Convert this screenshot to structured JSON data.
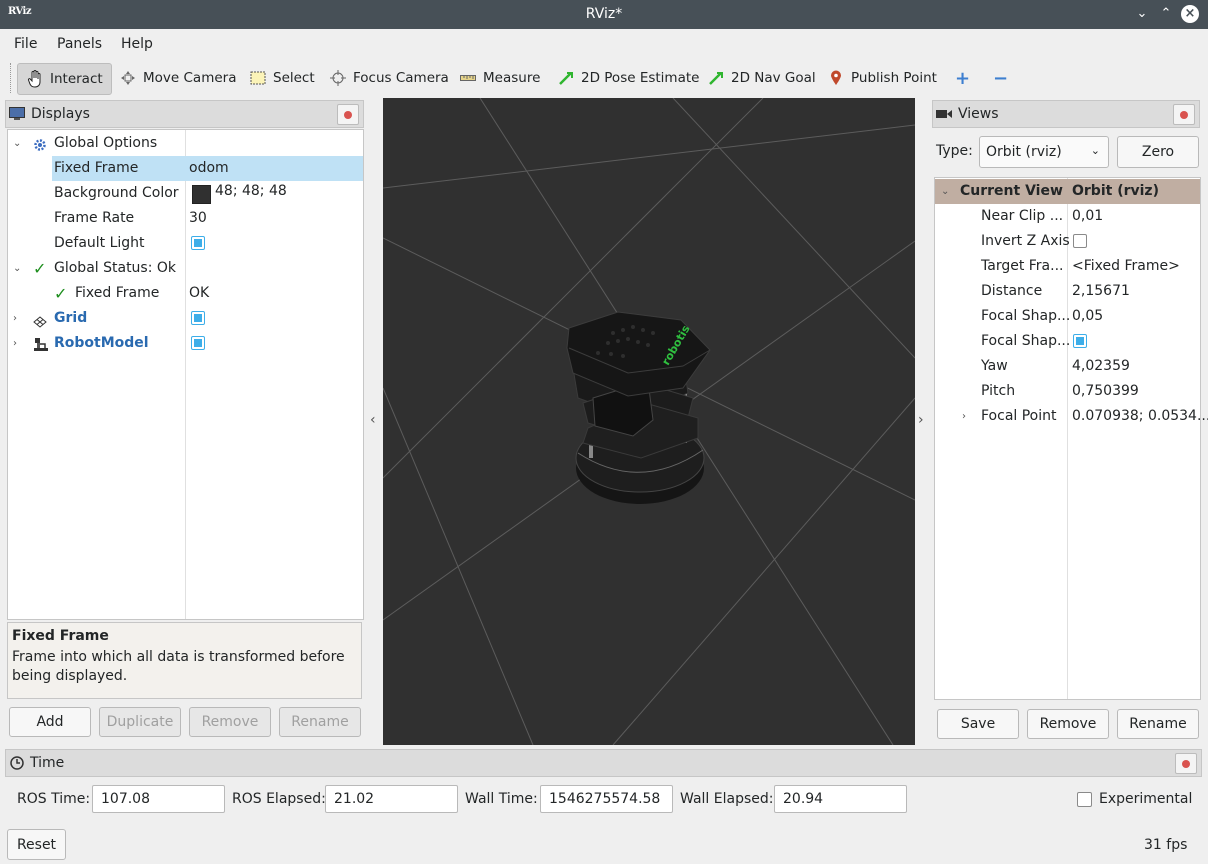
{
  "window": {
    "title": "RViz*",
    "logo": "RViz",
    "controls": {
      "minimize": "⌄",
      "maximize": "⌃",
      "close": "×"
    }
  },
  "menu": [
    "File",
    "Panels",
    "Help"
  ],
  "toolbar": {
    "interact": "Interact",
    "move_camera": "Move Camera",
    "select": "Select",
    "focus_camera": "Focus Camera",
    "measure": "Measure",
    "pose_estimate": "2D Pose Estimate",
    "nav_goal": "2D Nav Goal",
    "publish_point": "Publish Point",
    "add_icon": "+",
    "remove_icon": "−"
  },
  "displays": {
    "title": "Displays",
    "rows": [
      {
        "name": "Global Options",
        "value": ""
      },
      {
        "name": "Fixed Frame",
        "value": "odom"
      },
      {
        "name": "Background Color",
        "value": "48; 48; 48"
      },
      {
        "name": "Frame Rate",
        "value": "30"
      },
      {
        "name": "Default Light",
        "value": ""
      },
      {
        "name": "Global Status: Ok",
        "value": ""
      },
      {
        "name": "Fixed Frame",
        "value": "OK"
      },
      {
        "name": "Grid",
        "value": ""
      },
      {
        "name": "RobotModel",
        "value": ""
      }
    ],
    "description_title": "Fixed Frame",
    "description_text": "Frame into which all data is transformed before being displayed.",
    "buttons": {
      "add": "Add",
      "duplicate": "Duplicate",
      "remove": "Remove",
      "rename": "Rename"
    },
    "bg_color": "#303030"
  },
  "views": {
    "title": "Views",
    "type_label": "Type:",
    "type_value": "Orbit (rviz)",
    "zero": "Zero",
    "header": {
      "name": "Current View",
      "value": "Orbit (rviz)"
    },
    "rows": [
      {
        "name": "Near Clip ...",
        "value": "0,01"
      },
      {
        "name": "Invert Z Axis",
        "value": ""
      },
      {
        "name": "Target Fra...",
        "value": "<Fixed Frame>"
      },
      {
        "name": "Distance",
        "value": "2,15671"
      },
      {
        "name": "Focal Shap...",
        "value": "0,05"
      },
      {
        "name": "Focal Shap...",
        "value": ""
      },
      {
        "name": "Yaw",
        "value": "4,02359"
      },
      {
        "name": "Pitch",
        "value": "0,750399"
      },
      {
        "name": "Focal Point",
        "value": "0.070938; 0.0534..."
      }
    ],
    "buttons": {
      "save": "Save",
      "remove": "Remove",
      "rename": "Rename"
    }
  },
  "time": {
    "title": "Time",
    "ros_time_label": "ROS Time:",
    "ros_time": "107.08",
    "ros_elapsed_label": "ROS Elapsed:",
    "ros_elapsed": "21.02",
    "wall_time_label": "Wall Time:",
    "wall_time": "1546275574.58",
    "wall_elapsed_label": "Wall Elapsed:",
    "wall_elapsed": "20.94",
    "experimental": "Experimental"
  },
  "footer": {
    "reset": "Reset",
    "fps": "31 fps"
  },
  "colors": {
    "accent": "#3daee9",
    "selection": "#bfe1f5",
    "viewport_bg": "#303030",
    "titlebar": "#475057",
    "link": "#2a6ab0"
  },
  "robot": {
    "logo": "robotis"
  }
}
